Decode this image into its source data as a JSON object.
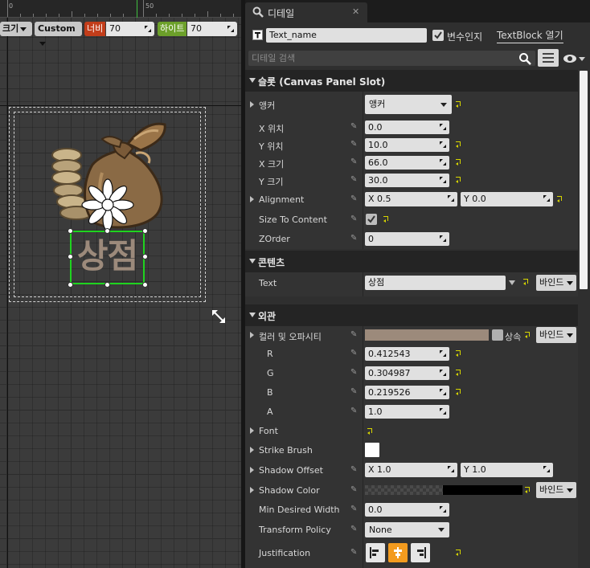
{
  "canvas": {
    "ruler_labels": [
      "0",
      "50"
    ],
    "toolbar": {
      "size_label": "크기",
      "size_mode": "Custom",
      "width_label": "너비",
      "width_value": "70",
      "height_label": "하이트",
      "height_value": "70"
    },
    "widget_text": "상점"
  },
  "details": {
    "tab_title": "디테일",
    "widget_name": "Text_name",
    "is_variable_label": "변수인지",
    "open_link": "TextBlock 열기",
    "search_placeholder": "디테일 검색",
    "slot": {
      "header": "슬롯 (Canvas Panel Slot)",
      "anchor_label": "앵커",
      "anchor_value": "앵커",
      "x_pos_label": "X 위치",
      "x_pos_value": "0.0",
      "y_pos_label": "Y 위치",
      "y_pos_value": "10.0",
      "x_size_label": "X 크기",
      "x_size_value": "66.0",
      "y_size_label": "Y 크기",
      "y_size_value": "30.0",
      "alignment_label": "Alignment",
      "alignment_x": "X  0.5",
      "alignment_y": "Y  0.0",
      "size_to_content_label": "Size To Content",
      "zorder_label": "ZOrder",
      "zorder_value": "0"
    },
    "content": {
      "header": "콘텐츠",
      "text_label": "Text",
      "text_value": "상점",
      "bind_label": "바인드"
    },
    "appearance": {
      "header": "외관",
      "color_label": "컬러 및 오파시티",
      "color_swatch": "#9c8a7b",
      "inherit_label": "상속",
      "bind_label": "바인드",
      "r_label": "R",
      "r_value": "0.412543",
      "g_label": "G",
      "g_value": "0.304987",
      "b_label": "B",
      "b_value": "0.219526",
      "a_label": "A",
      "a_value": "1.0",
      "font_label": "Font",
      "strike_brush_label": "Strike Brush",
      "shadow_offset_label": "Shadow Offset",
      "shadow_offset_x": "X  1.0",
      "shadow_offset_y": "Y  1.0",
      "shadow_color_label": "Shadow Color",
      "shadow_bind_label": "바인드",
      "min_width_label": "Min Desired Width",
      "min_width_value": "0.0",
      "transform_policy_label": "Transform Policy",
      "transform_policy_value": "None",
      "justification_label": "Justification"
    }
  }
}
